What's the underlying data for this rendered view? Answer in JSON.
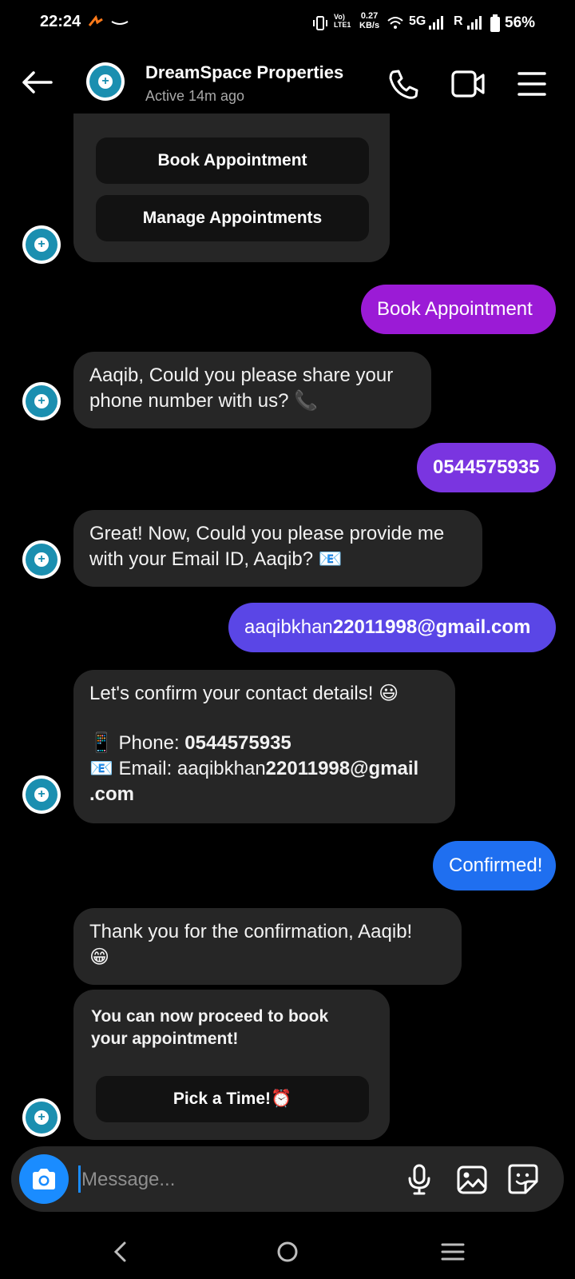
{
  "status_bar": {
    "time": "22:24",
    "volte_label": "Vo) LTE1",
    "speed_value": "0.27",
    "speed_unit": "KB/s",
    "network_label": "5G",
    "roaming_label": "R",
    "battery": "56%"
  },
  "header": {
    "contact_name": "DreamSpace Properties",
    "contact_status": "Active 14m ago"
  },
  "messages": {
    "quick_reply_1": "Book Appointment",
    "quick_reply_2": "Manage Appointments",
    "out_1": "Book Appointment",
    "in_1_line1": "Aaqib, Could you please share your",
    "in_1_line2": "phone number with us? 📞",
    "out_2": "0544575935",
    "in_2_line1": "Great! Now, Could you please provide me",
    "in_2_line2": "with your Email ID, Aaqib? 📧",
    "out_3_prefix": "aaqibkhan",
    "out_3_bold": "22011998@gmail.com",
    "in_3_line1": "Let's confirm your contact details! 😃",
    "in_3_phone_label": "📱 Phone: ",
    "in_3_phone_value": "0544575935",
    "in_3_email_label": "📧 Email: aaqibkhan",
    "in_3_email_value": "22011998@gmail",
    "in_3_email_end": ".com",
    "out_4": "Confirmed!",
    "in_4_line1": "Thank you for the confirmation, Aaqib!",
    "in_4_line2": "😁",
    "card_text_line1": "You can now proceed to book",
    "card_text_line2": "your appointment!",
    "card_button": "Pick a Time!⏰"
  },
  "composer": {
    "placeholder": "Message..."
  },
  "colors": {
    "out_purple": "#9b1bd6",
    "out_violet": "#7a35e0",
    "out_indigo": "#5a46e6",
    "out_blue": "#1f6ff0",
    "incoming_bg": "#262626"
  }
}
